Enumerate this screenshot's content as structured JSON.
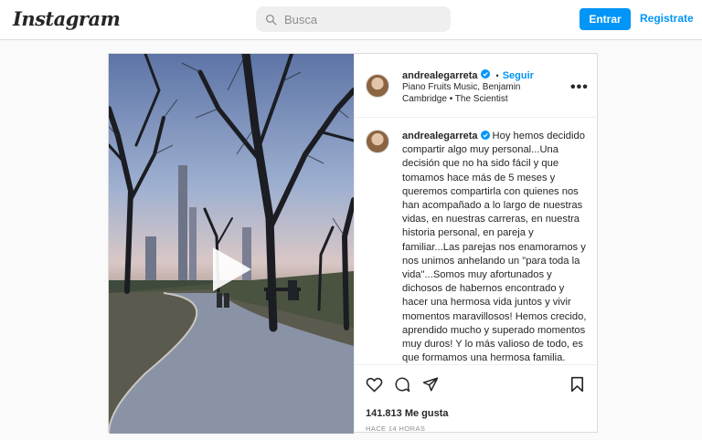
{
  "header": {
    "logo": "Instagram",
    "search_placeholder": "Busca",
    "login_label": "Entrar",
    "signup_label": "Registrate"
  },
  "post": {
    "username": "andrealegarreta",
    "separator": "•",
    "follow_label": "Seguir",
    "music": "Piano Fruits Music, Benjamin Cambridge • The Scientist",
    "more_label": "•••",
    "caption_username": "andrealegarreta",
    "caption": "Hoy hemos decidido compartir algo muy personal...Una decisión que no ha sido fácil y que tomamos hace más de 5 meses y queremos compartirla con quienes nos han acompañado a lo largo de nuestras vidas, en nuestras carreras, en nuestra historia personal, en pareja y familiar...Las parejas nos enamoramos y nos unimos anhelando un \"para toda la vida\"...Somos muy afortunados y dichosos de habernos encontrado y hacer una hermosa vida juntos y vivir momentos maravillosos! Hemos crecido, aprendido mucho y superado momentos muy duros! Y lo más valioso de todo, es que formamos una hermosa familia.",
    "likes": "141.813 Me gusta",
    "time": "HACE 14 HORAS"
  },
  "icons": {
    "search": "search-icon",
    "verified": "verified-badge-icon",
    "play": "play-icon",
    "like": "heart-icon",
    "comment": "comment-icon",
    "share": "share-icon",
    "save": "bookmark-icon"
  },
  "colors": {
    "accent": "#0095f6",
    "text": "#262626",
    "muted": "#8e8e8e",
    "border": "#dbdbdb"
  }
}
